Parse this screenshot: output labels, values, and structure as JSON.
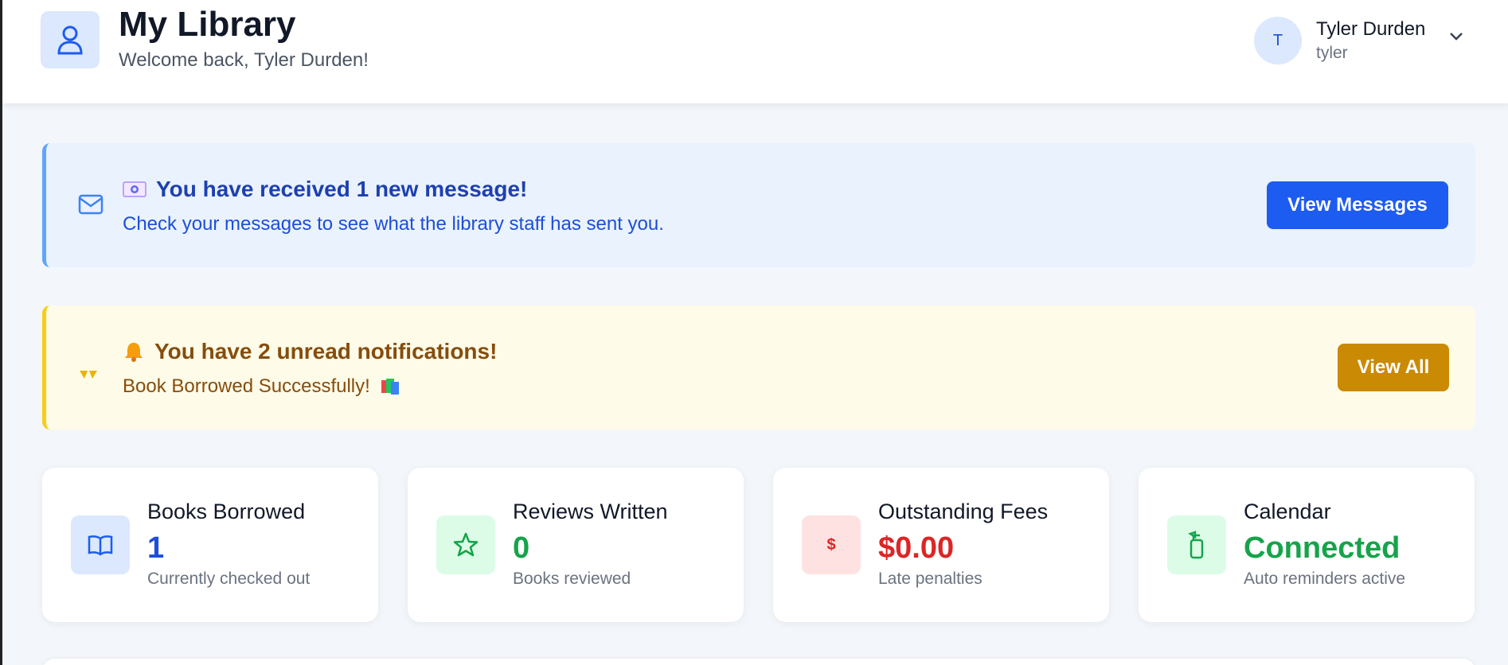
{
  "header": {
    "title": "My Library",
    "subtitle": "Welcome back, Tyler Durden!",
    "icon": "user-icon"
  },
  "user": {
    "initial": "T",
    "name": "Tyler Durden",
    "handle": "tyler"
  },
  "message_banner": {
    "title": "You have received 1 new message!",
    "body": "Check your messages to see what the library staff has sent you.",
    "button_label": "View Messages",
    "icon": "mail-icon",
    "emoji": "envelope-emoji"
  },
  "notification_banner": {
    "title": "You have 2 unread notifications!",
    "body": "Book Borrowed Successfully!",
    "button_label": "View All",
    "icon": "bell-off-icon",
    "emoji": "bell-emoji"
  },
  "stats": [
    {
      "label": "Books Borrowed",
      "value": "1",
      "sub": "Currently checked out",
      "icon": "book-open-icon",
      "color": "#1d4ed8",
      "bg": "#dbe8fd"
    },
    {
      "label": "Reviews Written",
      "value": "0",
      "sub": "Books reviewed",
      "icon": "star-icon",
      "color": "#16a34a",
      "bg": "#dcfce7"
    },
    {
      "label": "Outstanding Fees",
      "value": "$0.00",
      "sub": "Late penalties",
      "icon": "dollar-icon",
      "color": "#dc2626",
      "bg": "#fee2e2"
    },
    {
      "label": "Calendar",
      "value": "Connected",
      "sub": "Auto reminders active",
      "icon": "calendar-sync-icon",
      "color": "#16a34a",
      "bg": "#dcfce7"
    }
  ],
  "colors": {
    "primary": "#1d5cf0",
    "warning": "#ca8a04",
    "message_bg": "#eaf2fe",
    "notification_bg": "#fefbe8"
  }
}
